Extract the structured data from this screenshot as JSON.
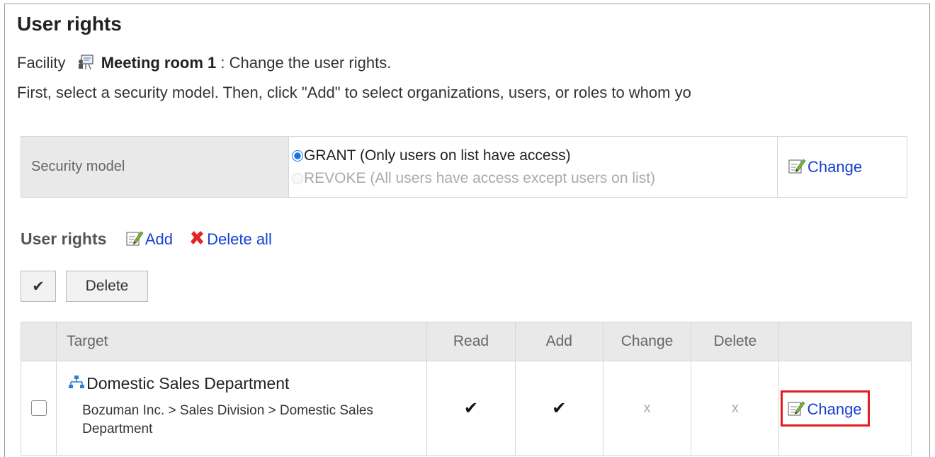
{
  "page": {
    "title": "User rights",
    "facility_prefix": "Facility",
    "facility_name": "Meeting room 1",
    "facility_suffix": ": Change the user rights.",
    "instructions": "First, select a security model. Then, click \"Add\" to select organizations, users, or roles to whom yo"
  },
  "security_model": {
    "label": "Security model",
    "options": [
      {
        "label": "GRANT (Only users on list have access)",
        "selected": true
      },
      {
        "label": "REVOKE (All users have access except users on list)",
        "selected": false
      }
    ],
    "change_label": "Change"
  },
  "user_rights": {
    "label": "User rights",
    "add_label": "Add",
    "delete_all_label": "Delete all",
    "check_button": "✔",
    "delete_button": "Delete"
  },
  "table": {
    "headers": {
      "target": "Target",
      "read": "Read",
      "add": "Add",
      "change": "Change",
      "delete": "Delete"
    },
    "rows": [
      {
        "target_name": "Domestic Sales Department",
        "target_path": "Bozuman Inc. > Sales Division > Domestic Sales Department",
        "read": "✔",
        "add": "✔",
        "change": "x",
        "delete": "x",
        "action_label": "Change"
      }
    ]
  },
  "colors": {
    "link": "#1540d4",
    "highlight": "#e31b23",
    "radio_selected": "#1a73e8"
  }
}
